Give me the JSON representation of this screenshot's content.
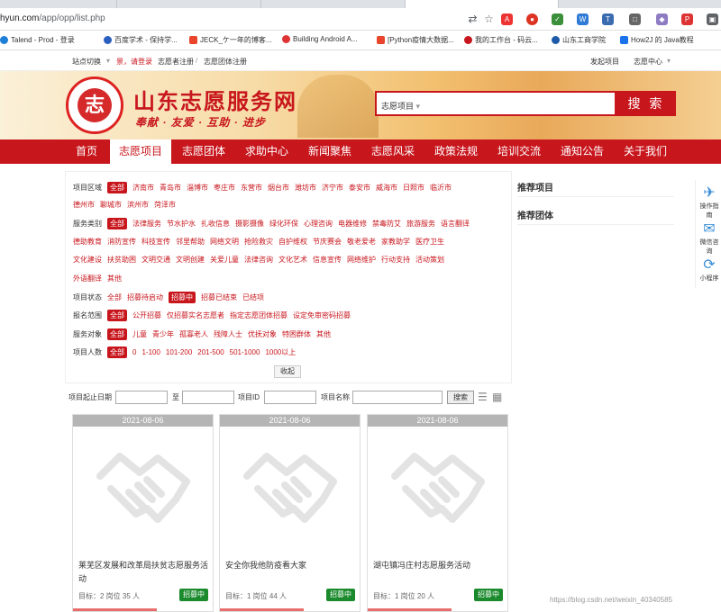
{
  "browser": {
    "url_prefix": "hyun.com",
    "url_path": "/app/opp/list.php",
    "bookmarks": [
      {
        "label": "Talend - Prod - 登录",
        "color": "#1e7fd8"
      },
      {
        "label": "百度学术 - 保持学...",
        "color": "#2b5ebf"
      },
      {
        "label": "JECK_ケ一年的博客...",
        "color": "#e8452c"
      },
      {
        "label": "Building Android A...",
        "color": "#d33"
      },
      {
        "label": "[Python疫情大数据...",
        "color": "#e8452c"
      },
      {
        "label": "我的工作台 - 码云...",
        "color": "#c7161e"
      },
      {
        "label": "山东工商学院",
        "color": "#1d5aa8"
      },
      {
        "label": "How2J 的 Java教程",
        "color": "#1a73e8"
      }
    ]
  },
  "topbar": {
    "switch_label": "站点切换",
    "login_prefix": "景，",
    "login_link": "请登录",
    "register_volunteer": "志愿者注册",
    "register_sep": " / ",
    "register_team": "志愿团体注册",
    "publish": "发起项目",
    "center": "志愿中心"
  },
  "banner": {
    "logo_char": "志",
    "site_title": "山东志愿服务网",
    "slogan": "奉献 · 友爱 · 互助 · 进步",
    "search_select": "志愿项目",
    "search_button": "搜 索"
  },
  "nav": [
    "首页",
    "志愿项目",
    "志愿团体",
    "求助中心",
    "新闻聚焦",
    "志愿风采",
    "政策法规",
    "培训交流",
    "通知公告",
    "关于我们"
  ],
  "filters": {
    "region": {
      "label": "项目区域",
      "selected": "全部",
      "row1": [
        "济南市",
        "青岛市",
        "淄博市",
        "枣庄市",
        "东营市",
        "烟台市",
        "潍坊市",
        "济宁市",
        "泰安市",
        "威海市",
        "日照市",
        "临沂市"
      ],
      "row2": [
        "德州市",
        "聊城市",
        "滨州市",
        "菏泽市"
      ]
    },
    "category": {
      "label": "服务类别",
      "selected": "全部",
      "row1": [
        "法律服务",
        "节水护水",
        "扎收信息",
        "摄影摄像",
        "绿化环保",
        "心理咨询",
        "电器维修",
        "禁毒防艾",
        "旅游服务",
        "语言翻译"
      ],
      "row2": [
        "德助教育",
        "消防宣传",
        "科技宣传",
        "邻里帮助",
        "网络文明",
        "抢险救灾",
        "自护维权",
        "节庆赛会",
        "敬老爱老",
        "家教助学",
        "医疗卫生"
      ],
      "row3": [
        "文化建设",
        "扶贫助困",
        "文明交通",
        "文明创建",
        "关爱儿童",
        "法律咨询",
        "文化艺术",
        "信息宣传",
        "网络维护",
        "行动支持",
        "活动策划"
      ],
      "row4": [
        "外语翻译",
        "其他"
      ]
    },
    "status": {
      "label": "项目状态",
      "all": "全部",
      "opts": [
        "招募待启动"
      ],
      "selected": "招募中",
      "opts2": [
        "招募已结束",
        "已结项"
      ]
    },
    "scope": {
      "label": "报名范围",
      "selected": "全部",
      "opts": [
        "公开招募",
        "仅招募实名志愿者",
        "指定志愿团体招募",
        "设定免审密码招募"
      ]
    },
    "target": {
      "label": "服务对象",
      "selected": "全部",
      "opts": [
        "儿童",
        "青少年",
        "孤寡老人",
        "残障人士",
        "优抚对象",
        "特困群体",
        "其他"
      ]
    },
    "count": {
      "label": "项目人数",
      "selected": "全部",
      "opts": [
        "0",
        "1-100",
        "101-200",
        "201-500",
        "501-1000",
        "1000以上"
      ]
    },
    "collapse": "收起"
  },
  "sidebar": {
    "recommended_projects": "推荐项目",
    "recommended_teams": "推荐团体"
  },
  "searchbar": {
    "date_label": "项目起止日期",
    "to": "至",
    "id_label": "项目ID",
    "name_label": "项目名称",
    "search": "搜索"
  },
  "cards": [
    {
      "date": "2021-08-06",
      "title": "莱芜区发展和改革局扶贫志愿服务活动",
      "goal": "目标：2 岗位 35 人",
      "status": "招募中"
    },
    {
      "date": "2021-08-06",
      "title": "安全你我他防疫看大家",
      "goal": "目标：1 岗位 44 人",
      "status": "招募中"
    },
    {
      "date": "2021-08-06",
      "title": "湖屯镇冯庄村志愿服务活动",
      "goal": "目标：1 岗位 20 人",
      "status": "招募中"
    }
  ],
  "float_bar": [
    "操作指南",
    "微信咨询",
    "小程序"
  ],
  "watermark": "https://blog.csdn.net/weixin_40340585"
}
